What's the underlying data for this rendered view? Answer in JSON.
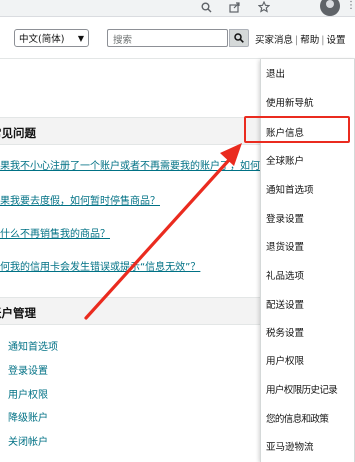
{
  "top_bar": {
    "language": "中文(简体)",
    "search_placeholder": "搜索",
    "links": [
      "买家消息",
      "帮助",
      "设置"
    ]
  },
  "faq": {
    "section_title": "常见问题",
    "questions": [
      "如果我不小心注册了一个账户或者不再需要我的账户了，如何关闭",
      "如果我要去度假，如何暂时停售商品？",
      "为什么不再销售我的商品？",
      "为何我的信用卡会发生错误或提示“信息无效”？"
    ]
  },
  "account": {
    "section_title": "账户管理",
    "links": [
      "通知首选项",
      "登录设置",
      "用户权限",
      "降级账户",
      "关闭帐户"
    ]
  },
  "settings_menu": {
    "items": [
      "退出",
      "使用新导航",
      "账户信息",
      "全球账户",
      "通知首选项",
      "登录设置",
      "退货设置",
      "礼品选项",
      "配送设置",
      "税务设置",
      "用户权限",
      "用户权限历史记录",
      "您的信息和政策",
      "亚马逊物流"
    ],
    "highlighted": "账户信息"
  },
  "colors": {
    "link": "#007185",
    "annotation": "#ea2b1f"
  },
  "icons": [
    "search-icon",
    "share-icon",
    "star-icon",
    "profile-icon",
    "more-icon",
    "chevron-down-icon"
  ]
}
